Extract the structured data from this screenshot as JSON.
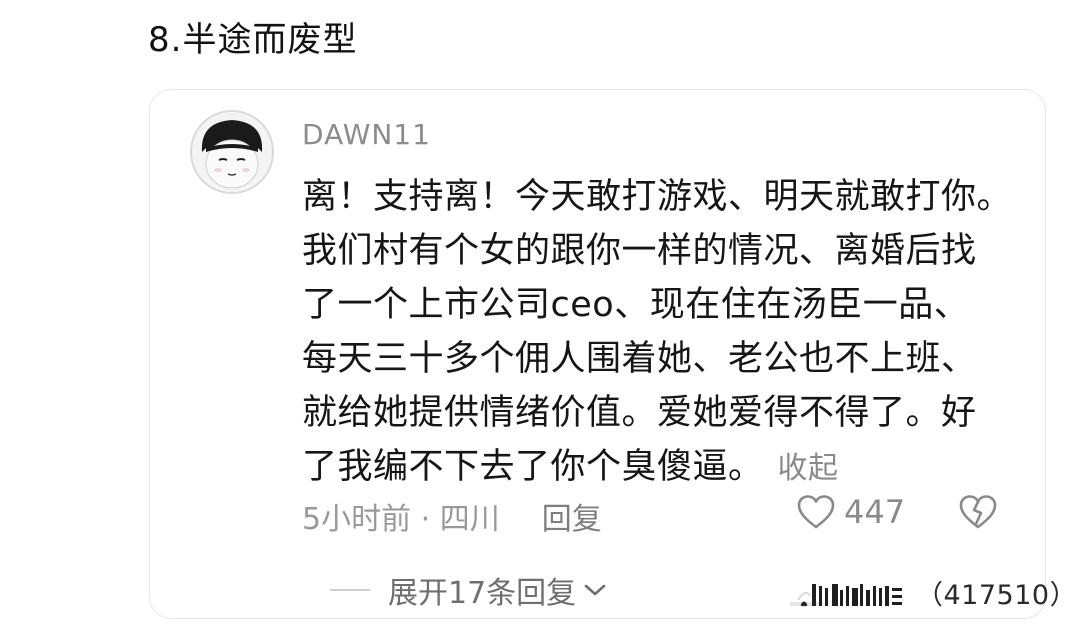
{
  "section": {
    "title": "8.半途而废型"
  },
  "comment": {
    "username": "DAWN11",
    "lines": [
      "离！支持离！今天敢打游戏、明天就敢打你。",
      "我们村有个女的跟你一样的情况、离婚后找",
      "了一个上市公司ceo、现在住在汤臣一品、",
      "每天三十多个佣人围着她、老公也不上班、",
      "就给她提供情绪价值。爱她爱得不得了。好",
      "了我编不下去了你个臭傻逼。"
    ],
    "collapse_label": "收起",
    "time": "5小时前 · 四川",
    "reply_label": "回复",
    "like_count": "447",
    "expand_label": "展开17条回复"
  },
  "watermark": {
    "id": "（417510）"
  },
  "icons": {
    "avatar": "cartoon-avatar",
    "like": "heart-outline-icon",
    "dislike": "broken-heart-icon",
    "expand": "chevron-down-icon",
    "watermark": "bars-logo-icon"
  },
  "colors": {
    "text_primary": "#161616",
    "text_secondary": "#999999",
    "card_border": "#e6e6e6"
  }
}
